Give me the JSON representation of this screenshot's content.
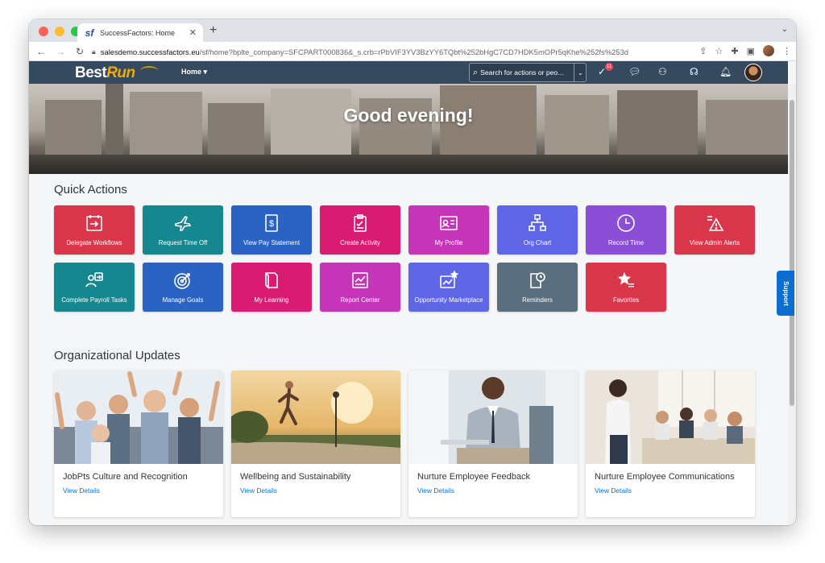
{
  "browser": {
    "tab_title": "SuccessFactors: Home",
    "tab_favicon": "sf",
    "url_host": "salesdemo.successfactors.eu",
    "url_path": "/sf/home?bplte_company=SFCPART000836&_s.crb=rPbVIF3YV3BzYY6TQbt%252bHgC7CD7HDK5mOPr5qKhe%252fs%253d"
  },
  "header": {
    "logo_best": "Best",
    "logo_run": "Run",
    "home_label": "Home",
    "search_placeholder": "Search for actions or peo...",
    "notification_count": "11"
  },
  "hero": {
    "greeting": "Good evening!"
  },
  "support_label": "Support",
  "quick_actions": {
    "title": "Quick Actions",
    "tiles": [
      {
        "label": "Delegate Workflows",
        "icon": "delegate-icon",
        "color": "#d9364c"
      },
      {
        "label": "Request Time Off",
        "icon": "airplane-icon",
        "color": "#16868f"
      },
      {
        "label": "View Pay Statement",
        "icon": "pay-statement-icon",
        "color": "#2a63c4"
      },
      {
        "label": "Create Activity",
        "icon": "clipboard-icon",
        "color": "#d81b73"
      },
      {
        "label": "My Profile",
        "icon": "profile-card-icon",
        "color": "#c535b7"
      },
      {
        "label": "Org Chart",
        "icon": "org-chart-icon",
        "color": "#5e66e6"
      },
      {
        "label": "Record Time",
        "icon": "clock-icon",
        "color": "#8b4fd6"
      },
      {
        "label": "View Admin Alerts",
        "icon": "alert-icon",
        "color": "#d9364c"
      },
      {
        "label": "Complete Payroll Tasks",
        "icon": "payroll-icon",
        "color": "#16868f"
      },
      {
        "label": "Manage Goals",
        "icon": "target-icon",
        "color": "#2a63c4"
      },
      {
        "label": "My Learning",
        "icon": "book-icon",
        "color": "#d81b73"
      },
      {
        "label": "Report Center",
        "icon": "report-icon",
        "color": "#c535b7"
      },
      {
        "label": "Opportunity Marketplace",
        "icon": "marketplace-icon",
        "color": "#5e66e6"
      },
      {
        "label": "Reminders",
        "icon": "reminder-icon",
        "color": "#5b6e7d"
      },
      {
        "label": "Favorites",
        "icon": "star-icon",
        "color": "#d9364c"
      }
    ]
  },
  "org_updates": {
    "title": "Organizational Updates",
    "cards": [
      {
        "title": "JobPts Culture and Recognition",
        "link": "View Details"
      },
      {
        "title": "Wellbeing and Sustainability",
        "link": "View Details"
      },
      {
        "title": "Nurture Employee Feedback",
        "link": "View Details"
      },
      {
        "title": "Nurture Employee Communications",
        "link": "View Details"
      }
    ]
  }
}
